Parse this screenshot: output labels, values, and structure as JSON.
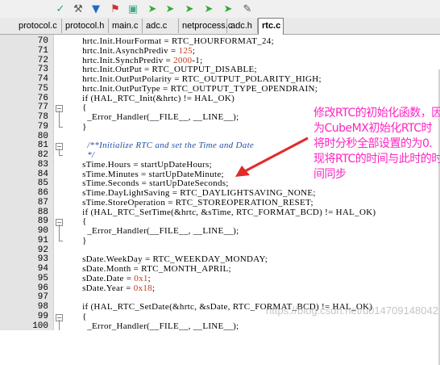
{
  "toolbar": {
    "icons": [
      "check-icon",
      "tool-icon",
      "funnel-icon",
      "debug-icon",
      "window-icon",
      "nav-icon",
      "nav-icon",
      "nav-icon",
      "nav-icon",
      "nav-icon",
      "wrench-icon"
    ]
  },
  "tabs": [
    {
      "label": "protocol.c",
      "active": false
    },
    {
      "label": "protocol.h",
      "active": false
    },
    {
      "label": "main.c",
      "active": false
    },
    {
      "label": "adc.c",
      "active": false
    },
    {
      "label": "netprocess.c",
      "active": false
    },
    {
      "label": "adc.h",
      "active": false
    },
    {
      "label": "rtc.c",
      "active": true
    }
  ],
  "editor": {
    "lines": [
      {
        "n": "70",
        "text": "  hrtc.Init.HourFormat = RTC_HOURFORMAT_24;",
        "fold": ""
      },
      {
        "n": "71",
        "text": "  hrtc.Init.AsynchPrediv = ",
        "num": "125",
        "tail": ";",
        "fold": ""
      },
      {
        "n": "72",
        "text": "  hrtc.Init.SynchPrediv = ",
        "num": "2000",
        "tail": "-1;",
        "fold": ""
      },
      {
        "n": "73",
        "text": "  hrtc.Init.OutPut = RTC_OUTPUT_DISABLE;",
        "fold": ""
      },
      {
        "n": "74",
        "text": "  hrtc.Init.OutPutPolarity = RTC_OUTPUT_POLARITY_HIGH;",
        "fold": ""
      },
      {
        "n": "75",
        "text": "  hrtc.Init.OutPutType = RTC_OUTPUT_TYPE_OPENDRAIN;",
        "fold": ""
      },
      {
        "n": "76",
        "text": "  if (HAL_RTC_Init(&hrtc) != HAL_OK)",
        "fold": ""
      },
      {
        "n": "77",
        "text": "  {",
        "fold": "box"
      },
      {
        "n": "78",
        "text": "    _Error_Handler(__FILE__, __LINE__);",
        "fold": "line"
      },
      {
        "n": "79",
        "text": "  }",
        "fold": "end"
      },
      {
        "n": "80",
        "text": "",
        "fold": ""
      },
      {
        "n": "81",
        "text": "    /**Initialize RTC and set the Time and Date",
        "comment": true,
        "fold": "box"
      },
      {
        "n": "82",
        "text": "    */",
        "comment": true,
        "fold": "end"
      },
      {
        "n": "83",
        "text": "  sTime.Hours = startUpDateHours;",
        "fold": ""
      },
      {
        "n": "84",
        "text": "  sTime.Minutes = startUpDateMinute;",
        "fold": ""
      },
      {
        "n": "85",
        "text": "  sTime.Seconds = startUpDateSeconds;",
        "fold": ""
      },
      {
        "n": "86",
        "text": "  sTime.DayLightSaving = RTC_DAYLIGHTSAVING_NONE;",
        "fold": ""
      },
      {
        "n": "87",
        "text": "  sTime.StoreOperation = RTC_STOREOPERATION_RESET;",
        "fold": ""
      },
      {
        "n": "88",
        "text": "  if (HAL_RTC_SetTime(&hrtc, &sTime, RTC_FORMAT_BCD) != HAL_OK)",
        "fold": ""
      },
      {
        "n": "89",
        "text": "  {",
        "fold": "box"
      },
      {
        "n": "90",
        "text": "    _Error_Handler(__FILE__, __LINE__);",
        "fold": "line"
      },
      {
        "n": "91",
        "text": "  }",
        "fold": "end"
      },
      {
        "n": "92",
        "text": "",
        "fold": ""
      },
      {
        "n": "93",
        "text": "  sDate.WeekDay = RTC_WEEKDAY_MONDAY;",
        "fold": ""
      },
      {
        "n": "94",
        "text": "  sDate.Month = RTC_MONTH_APRIL;",
        "fold": ""
      },
      {
        "n": "95",
        "text": "  sDate.Date = ",
        "num": "0x1",
        "tail": ";",
        "fold": ""
      },
      {
        "n": "96",
        "text": "  sDate.Year = ",
        "num": "0x18",
        "tail": ";",
        "fold": ""
      },
      {
        "n": "97",
        "text": "",
        "fold": ""
      },
      {
        "n": "98",
        "text": "  if (HAL_RTC_SetDate(&hrtc, &sDate, RTC_FORMAT_BCD) != HAL_OK)",
        "fold": ""
      },
      {
        "n": "99",
        "text": "  {",
        "fold": "box"
      },
      {
        "n": "100",
        "text": "    _Error_Handler(__FILE__, __LINE__);",
        "fold": "line"
      }
    ]
  },
  "annotation": {
    "text": "修改RTC的初始化函数，因为CubeMX初始化RTC时将时分秒全部设置的为0.现将RTC的时间与此时的时间同步",
    "color": "#ff23c2"
  },
  "watermark": "https://blog.csdn.net/u014709148042"
}
